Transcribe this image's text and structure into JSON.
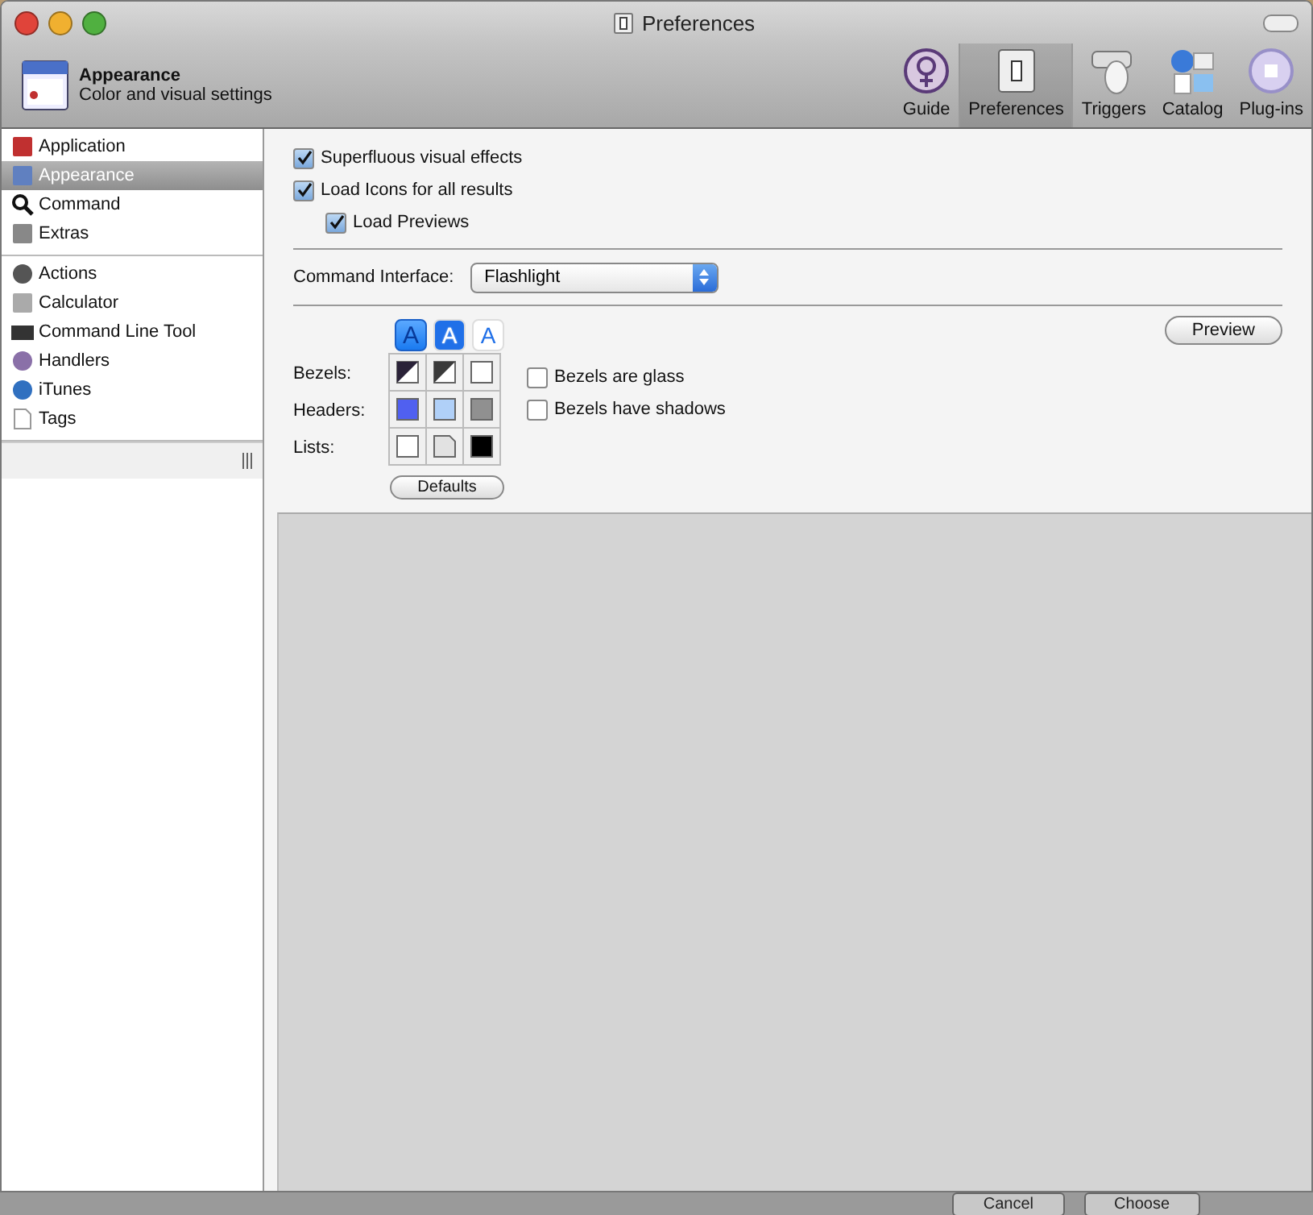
{
  "window": {
    "title": "Preferences"
  },
  "header": {
    "title": "Appearance",
    "subtitle": "Color and visual settings"
  },
  "toolbar": [
    {
      "label": "Guide",
      "selected": false
    },
    {
      "label": "Preferences",
      "selected": true
    },
    {
      "label": "Triggers",
      "selected": false
    },
    {
      "label": "Catalog",
      "selected": false
    },
    {
      "label": "Plug-ins",
      "selected": false
    }
  ],
  "sidebar": {
    "groups": [
      [
        {
          "label": "Application",
          "selected": false
        },
        {
          "label": "Appearance",
          "selected": true
        },
        {
          "label": "Command",
          "selected": false
        },
        {
          "label": "Extras",
          "selected": false
        }
      ],
      [
        {
          "label": "Actions",
          "selected": false
        },
        {
          "label": "Calculator",
          "selected": false
        },
        {
          "label": "Command Line Tool",
          "selected": false
        },
        {
          "label": "Handlers",
          "selected": false
        },
        {
          "label": "iTunes",
          "selected": false
        },
        {
          "label": "Tags",
          "selected": false
        }
      ]
    ]
  },
  "options": [
    {
      "label": "Superfluous visual effects",
      "checked": true,
      "indented": false
    },
    {
      "label": "Load Icons for all results",
      "checked": true,
      "indented": false
    },
    {
      "label": "Load Previews",
      "checked": true,
      "indented": true
    }
  ],
  "command_interface": {
    "label": "Command Interface:",
    "value": "Flashlight"
  },
  "preview_button": "Preview",
  "font_styles": [
    {
      "label": "A",
      "selected": true
    },
    {
      "label": "A",
      "selected": false
    },
    {
      "label": "A",
      "selected": false
    }
  ],
  "swatch_rows": [
    {
      "label": "Bezels:",
      "swatches": [
        {
          "kind": "split",
          "color": "#2a2238"
        },
        {
          "kind": "split",
          "color": "#3a3a3a"
        },
        {
          "kind": "solid",
          "color": "#ffffff"
        }
      ]
    },
    {
      "label": "Headers:",
      "swatches": [
        {
          "kind": "solid",
          "color": "#5060f0"
        },
        {
          "kind": "solid",
          "color": "#b0d0f8"
        },
        {
          "kind": "solid",
          "color": "#909090"
        }
      ]
    },
    {
      "label": "Lists:",
      "swatches": [
        {
          "kind": "solid",
          "color": "#ffffff"
        },
        {
          "kind": "folded",
          "color": "#e2e2e2"
        },
        {
          "kind": "solid",
          "color": "#000000"
        }
      ]
    }
  ],
  "bezel_options": [
    {
      "label": "Bezels are glass",
      "checked": false
    },
    {
      "label": "Bezels have shadows",
      "checked": false
    }
  ],
  "defaults_button": "Defaults",
  "background_buttons": [
    "Cancel",
    "Choose"
  ]
}
